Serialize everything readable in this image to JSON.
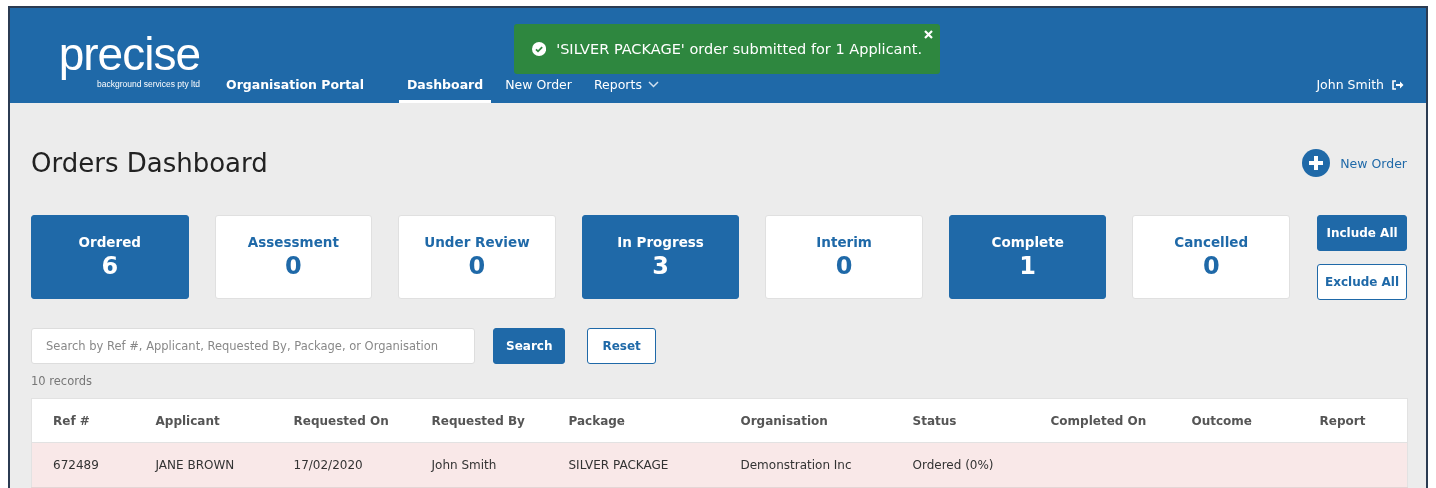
{
  "logo": {
    "name": "precise",
    "tagline": "background services pty ltd"
  },
  "nav": [
    {
      "label": "Organisation Portal",
      "kind": "brand",
      "selected": false
    },
    {
      "label": "Dashboard",
      "kind": "link",
      "selected": true
    },
    {
      "label": "New Order",
      "kind": "link",
      "selected": false
    },
    {
      "label": "Reports",
      "kind": "dropdown",
      "selected": false
    }
  ],
  "user": {
    "name": "John Smith"
  },
  "toast": {
    "message": "'SILVER PACKAGE' order submitted for 1 Applicant."
  },
  "page_title": "Orders Dashboard",
  "new_order_link": "New Order",
  "status_cards": [
    {
      "label": "Ordered",
      "count": "6",
      "selected": true
    },
    {
      "label": "Assessment",
      "count": "0",
      "selected": false
    },
    {
      "label": "Under Review",
      "count": "0",
      "selected": false
    },
    {
      "label": "In Progress",
      "count": "3",
      "selected": true
    },
    {
      "label": "Interim",
      "count": "0",
      "selected": false
    },
    {
      "label": "Complete",
      "count": "1",
      "selected": true
    },
    {
      "label": "Cancelled",
      "count": "0",
      "selected": false
    }
  ],
  "filter_buttons": [
    {
      "label": "Include All",
      "kind": "primary"
    },
    {
      "label": "Exclude All",
      "kind": "outline"
    }
  ],
  "search": {
    "placeholder": "Search by Ref #, Applicant, Requested By, Package, or Organisation",
    "button": "Search",
    "reset": "Reset"
  },
  "record_count": "10 records",
  "table": {
    "columns": [
      "Ref #",
      "Applicant",
      "Requested On",
      "Requested By",
      "Package",
      "Organisation",
      "Status",
      "Completed On",
      "Outcome",
      "Report"
    ],
    "rows": [
      [
        "672489",
        "JANE BROWN",
        "17/02/2020",
        "John Smith",
        "SILVER PACKAGE",
        "Demonstration Inc",
        "Ordered (0%)",
        "",
        "",
        ""
      ]
    ]
  }
}
